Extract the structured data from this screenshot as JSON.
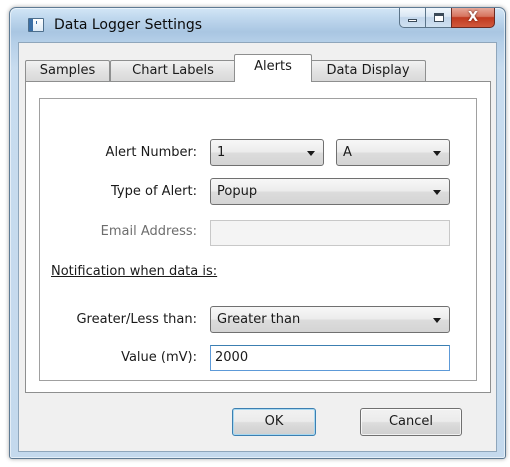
{
  "window": {
    "title": "Data Logger Settings",
    "close_glyph": "X"
  },
  "tabs": [
    {
      "label": "Samples",
      "active": false
    },
    {
      "label": "Chart Labels",
      "active": false
    },
    {
      "label": "Alerts",
      "active": true
    },
    {
      "label": "Data Display",
      "active": false
    }
  ],
  "form": {
    "alert_number": {
      "label": "Alert Number:",
      "value": "1",
      "channel": "A"
    },
    "type_of_alert": {
      "label": "Type of Alert:",
      "value": "Popup"
    },
    "email_address": {
      "label": "Email Address:",
      "value": "",
      "enabled": false
    },
    "notification_heading": "Notification when data is:",
    "greater_less": {
      "label": "Greater/Less than:",
      "value": "Greater than"
    },
    "value_mv": {
      "label": "Value (mV):",
      "value": "2000"
    }
  },
  "buttons": {
    "ok": "OK",
    "cancel": "Cancel"
  },
  "icons": [
    "app-window-icon",
    "minimize-icon",
    "maximize-icon",
    "close-icon",
    "chevron-down-icon"
  ]
}
